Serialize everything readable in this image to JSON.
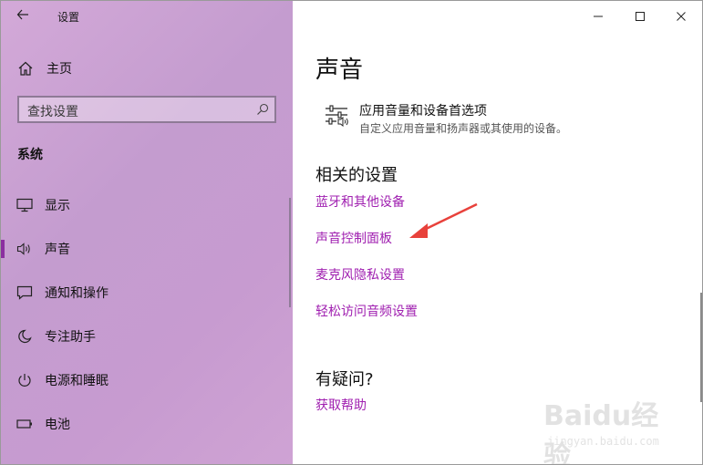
{
  "app": {
    "title": "设置"
  },
  "sidebar": {
    "home_label": "主页",
    "search_placeholder": "查找设置",
    "section_title": "系统",
    "items": [
      {
        "label": "显示",
        "icon": "monitor-icon"
      },
      {
        "label": "声音",
        "icon": "speaker-icon",
        "active": true
      },
      {
        "label": "通知和操作",
        "icon": "notification-icon"
      },
      {
        "label": "专注助手",
        "icon": "moon-icon"
      },
      {
        "label": "电源和睡眠",
        "icon": "power-icon"
      },
      {
        "label": "电池",
        "icon": "battery-icon"
      }
    ]
  },
  "main": {
    "title": "声音",
    "option": {
      "title": "应用音量和设备首选项",
      "description": "自定义应用音量和扬声器或其使用的设备。",
      "icon": "mixer-sliders-icon"
    },
    "related_heading": "相关的设置",
    "related_links": [
      "蓝牙和其他设备",
      "声音控制面板",
      "麦克风隐私设置",
      "轻松访问音频设置"
    ],
    "help_heading": "有疑问?",
    "help_link": "获取帮助"
  },
  "window_controls": {
    "minimize": "minimize-icon",
    "maximize": "maximize-icon",
    "close": "close-icon"
  },
  "watermark": {
    "main": "Baidu经验",
    "sub": "jingyan.baidu.com"
  },
  "colors": {
    "accent": "#a020b0",
    "sidebar": "#c79bd0",
    "arrow": "#e8413b"
  }
}
